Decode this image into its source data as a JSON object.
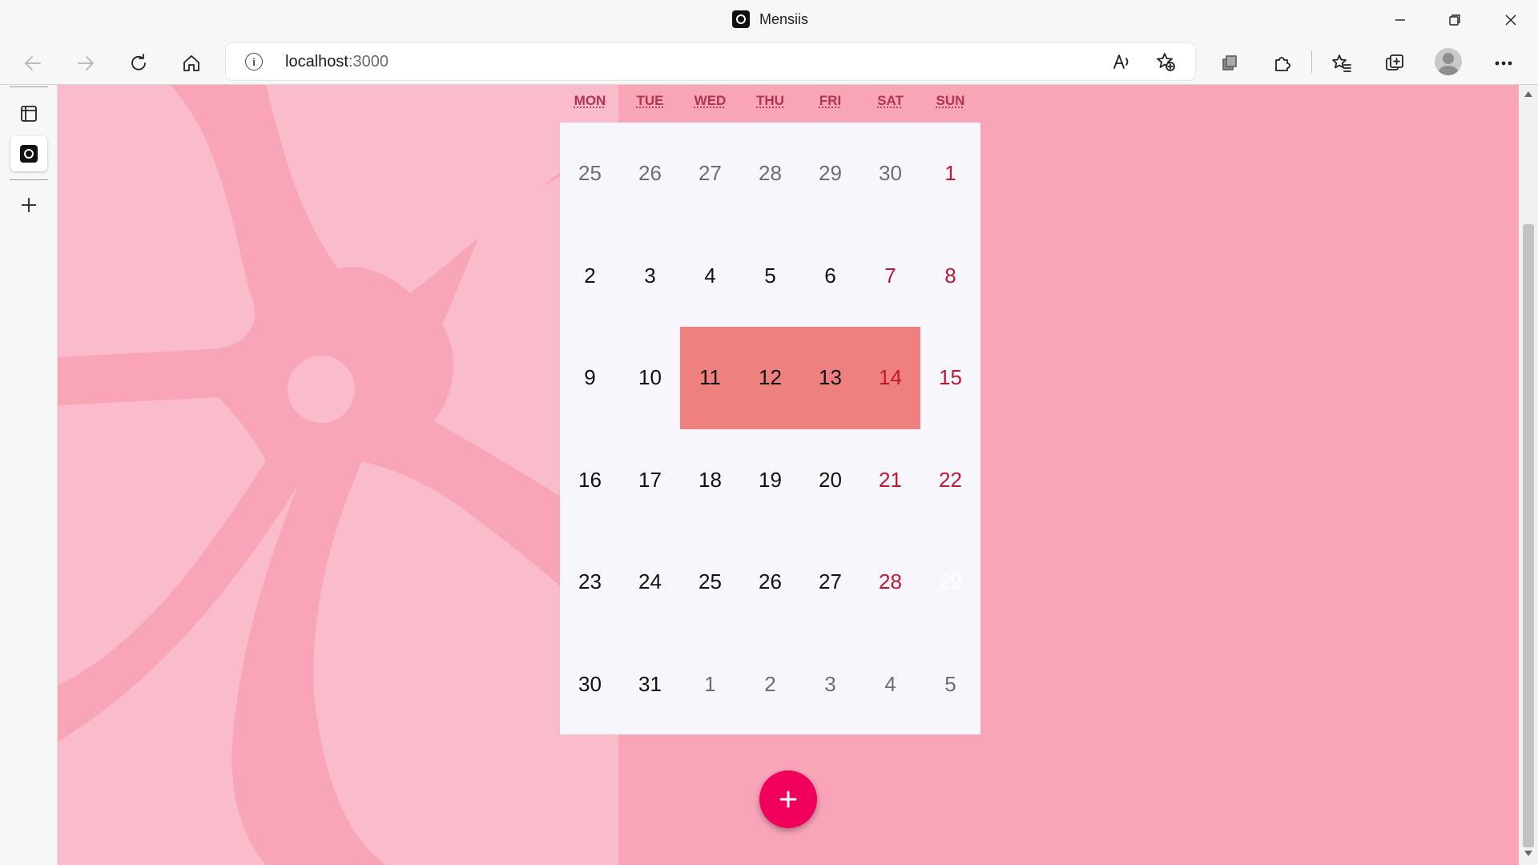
{
  "browser": {
    "tab_title": "Mensiis",
    "url_host": "localhost",
    "url_port": ":3000"
  },
  "calendar": {
    "weekdays": [
      "MON",
      "TUE",
      "WED",
      "THU",
      "FRI",
      "SAT",
      "SUN"
    ],
    "weeks": [
      [
        "25",
        "26",
        "27",
        "28",
        "29",
        "30",
        "1"
      ],
      [
        "2",
        "3",
        "4",
        "5",
        "6",
        "7",
        "8"
      ],
      [
        "9",
        "10",
        "11",
        "12",
        "13",
        "14",
        "15"
      ],
      [
        "16",
        "17",
        "18",
        "19",
        "20",
        "21",
        "22"
      ],
      [
        "23",
        "24",
        "25",
        "26",
        "27",
        "28",
        "29"
      ],
      [
        "30",
        "31",
        "1",
        "2",
        "3",
        "4",
        "5"
      ]
    ],
    "highlighted_days": [
      "11",
      "12",
      "13",
      "14"
    ]
  },
  "colors": {
    "background": "#f9a5b8",
    "flower": "#fabbcb",
    "highlight": "#ef8080",
    "weekend": "#c0192f",
    "fab": "#f0005a"
  },
  "fab": {
    "icon": "plus-icon"
  }
}
